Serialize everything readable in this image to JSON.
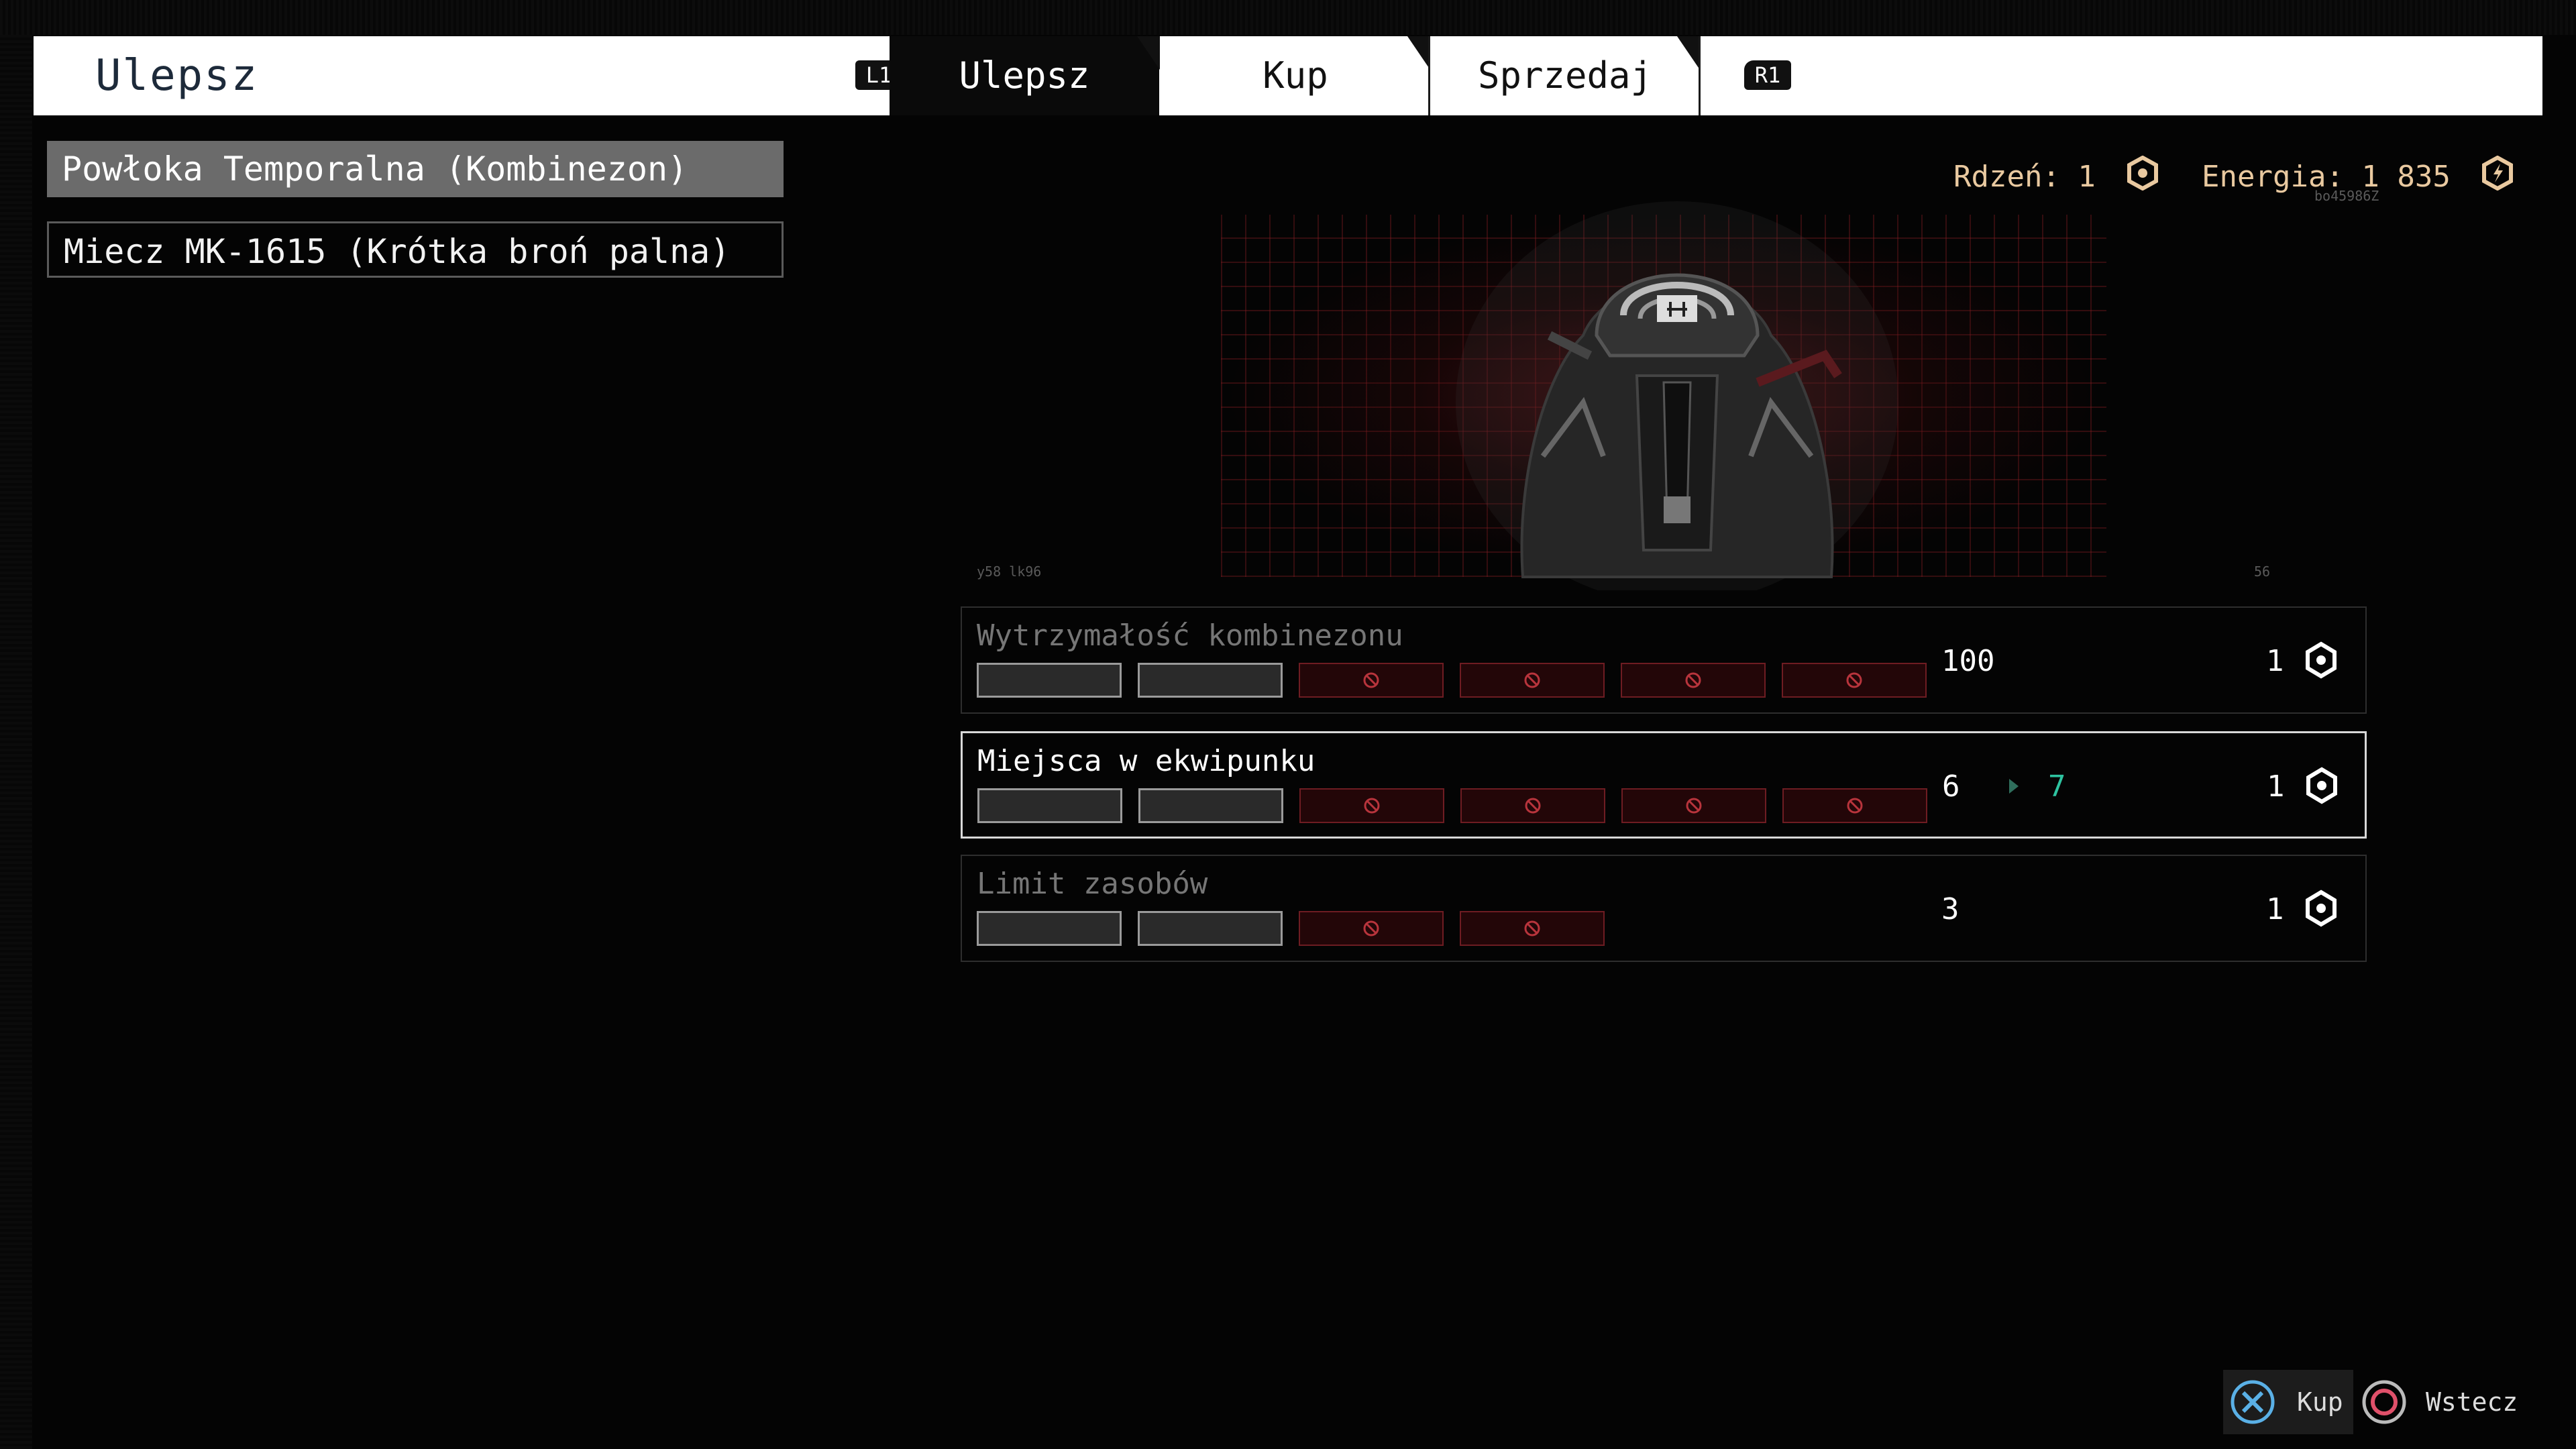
{
  "header": {
    "title": "Ulepsz",
    "left_button": "L1",
    "right_button": "R1",
    "tabs": [
      {
        "label": "Ulepsz",
        "active": true
      },
      {
        "label": "Kup",
        "active": false
      },
      {
        "label": "Sprzedaj",
        "active": false
      }
    ]
  },
  "items": [
    {
      "label": "Powłoka Temporalna (Kombinezon)",
      "selected": true
    },
    {
      "label": "Miecz MK-1615 (Krótka broń palna)",
      "selected": false
    }
  ],
  "currency": {
    "core": "Rdzeń: 1",
    "energy": "Energia: 1 835",
    "color": "#e9c9a0"
  },
  "preview": {
    "tag_left": "y58 lk96",
    "tag_right": "56",
    "tag_top_right": "bo45986Z"
  },
  "stats": [
    {
      "name": "Wytrzymałość kombinezonu",
      "value": "100",
      "next": "",
      "cost": "1",
      "filled": 2,
      "locked": 4,
      "highlighted": false
    },
    {
      "name": "Miejsca w ekwipunku",
      "value": "6",
      "next": "7",
      "cost": "1",
      "filled": 2,
      "locked": 4,
      "highlighted": true
    },
    {
      "name": "Limit zasobów",
      "value": "3",
      "next": "",
      "cost": "1",
      "filled": 2,
      "locked": 2,
      "highlighted": false
    }
  ],
  "prompts": [
    {
      "label": "Kup",
      "icon": "cross-button-icon"
    },
    {
      "label": "Wstecz",
      "icon": "circle-button-icon"
    }
  ],
  "colors": {
    "accent_green": "#2ec3a0",
    "locked_red": "#6e1c22",
    "cross": "#5ab0e6",
    "circle": "#e0506a"
  }
}
